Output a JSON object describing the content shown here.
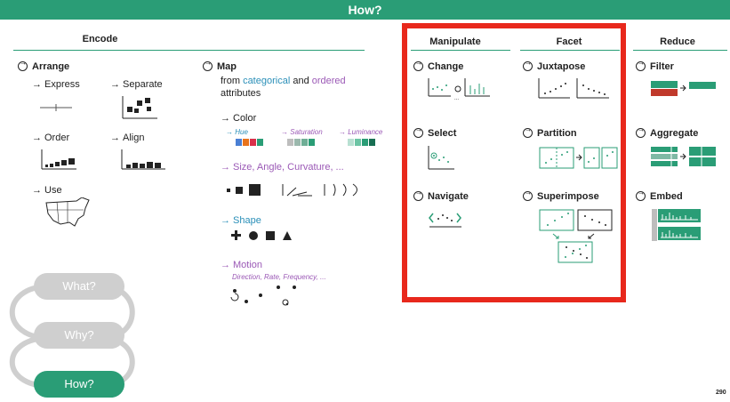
{
  "banner": "How?",
  "columns": {
    "encode": "Encode",
    "manipulate": "Manipulate",
    "facet": "Facet",
    "reduce": "Reduce"
  },
  "arrange": {
    "title": "Arrange",
    "express": "Express",
    "separate": "Separate",
    "order": "Order",
    "align": "Align",
    "use": "Use"
  },
  "map": {
    "title": "Map",
    "from": "from",
    "categorical": "categorical",
    "and": "and",
    "ordered": "ordered",
    "attributes": "attributes",
    "color": "Color",
    "hue": "Hue",
    "saturation": "Saturation",
    "luminance": "Luminance",
    "size": "Size, Angle, Curvature, ...",
    "shape": "Shape",
    "motion": "Motion",
    "motion_sub": "Direction, Rate, Frequency, ..."
  },
  "manipulate": {
    "change": "Change",
    "select": "Select",
    "navigate": "Navigate"
  },
  "facet": {
    "juxtapose": "Juxtapose",
    "partition": "Partition",
    "superimpose": "Superimpose"
  },
  "reduce": {
    "filter": "Filter",
    "aggregate": "Aggregate",
    "embed": "Embed"
  },
  "nav": {
    "what": "What?",
    "why": "Why?",
    "how": "How?"
  },
  "page_number": "290",
  "colors": {
    "teal": "#2a9d76",
    "red": "#c0392b",
    "highlight": "#e8281c",
    "gray": "#bdbdbd"
  }
}
